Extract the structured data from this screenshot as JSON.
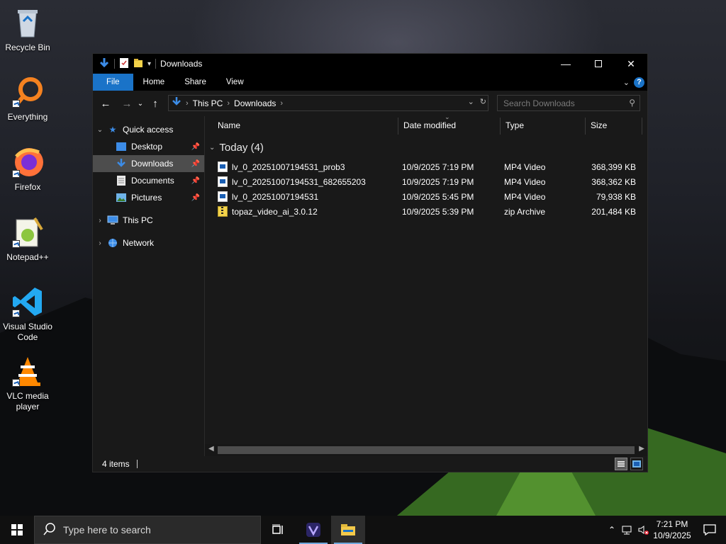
{
  "desktop": {
    "icons": [
      {
        "label": "Recycle Bin",
        "icon": "recycle-bin-icon"
      },
      {
        "label": "Everything",
        "icon": "everything-search-icon"
      },
      {
        "label": "Firefox",
        "icon": "firefox-icon"
      },
      {
        "label": "Notepad++",
        "icon": "notepad-plus-plus-icon"
      },
      {
        "label": "Visual Studio Code",
        "icon": "vscode-icon"
      },
      {
        "label": "VLC media player",
        "icon": "vlc-icon"
      }
    ]
  },
  "window": {
    "title": "Downloads",
    "ribbon_tabs": [
      "File",
      "Home",
      "Share",
      "View"
    ],
    "address": {
      "crumbs": [
        "This PC",
        "Downloads"
      ]
    },
    "search": {
      "placeholder": "Search Downloads"
    },
    "nav": {
      "quick_access": "Quick access",
      "items": [
        {
          "label": "Desktop",
          "pinned": true
        },
        {
          "label": "Downloads",
          "pinned": true,
          "selected": true
        },
        {
          "label": "Documents",
          "pinned": true
        },
        {
          "label": "Pictures",
          "pinned": true
        }
      ],
      "this_pc": "This PC",
      "network": "Network"
    },
    "columns": [
      "Name",
      "Date modified",
      "Type",
      "Size"
    ],
    "group": "Today (4)",
    "files": [
      {
        "name": "lv_0_20251007194531_prob3",
        "date": "10/9/2025 7:19 PM",
        "type": "MP4 Video",
        "size": "368,399 KB",
        "kind": "video"
      },
      {
        "name": "lv_0_20251007194531_682655203",
        "date": "10/9/2025 7:19 PM",
        "type": "MP4 Video",
        "size": "368,362 KB",
        "kind": "video"
      },
      {
        "name": "lv_0_20251007194531",
        "date": "10/9/2025 5:45 PM",
        "type": "MP4 Video",
        "size": "79,938 KB",
        "kind": "video"
      },
      {
        "name": "topaz_video_ai_3.0.12",
        "date": "10/9/2025 5:39 PM",
        "type": "zip Archive",
        "size": "201,484 KB",
        "kind": "zip"
      }
    ],
    "status": "4 items"
  },
  "taskbar": {
    "search_placeholder": "Type here to search",
    "time": "7:21 PM",
    "date": "10/9/2025"
  },
  "colors": {
    "accent": "#1a73c8",
    "window_bg": "#191919",
    "selected_bg": "#4d4d4d"
  }
}
